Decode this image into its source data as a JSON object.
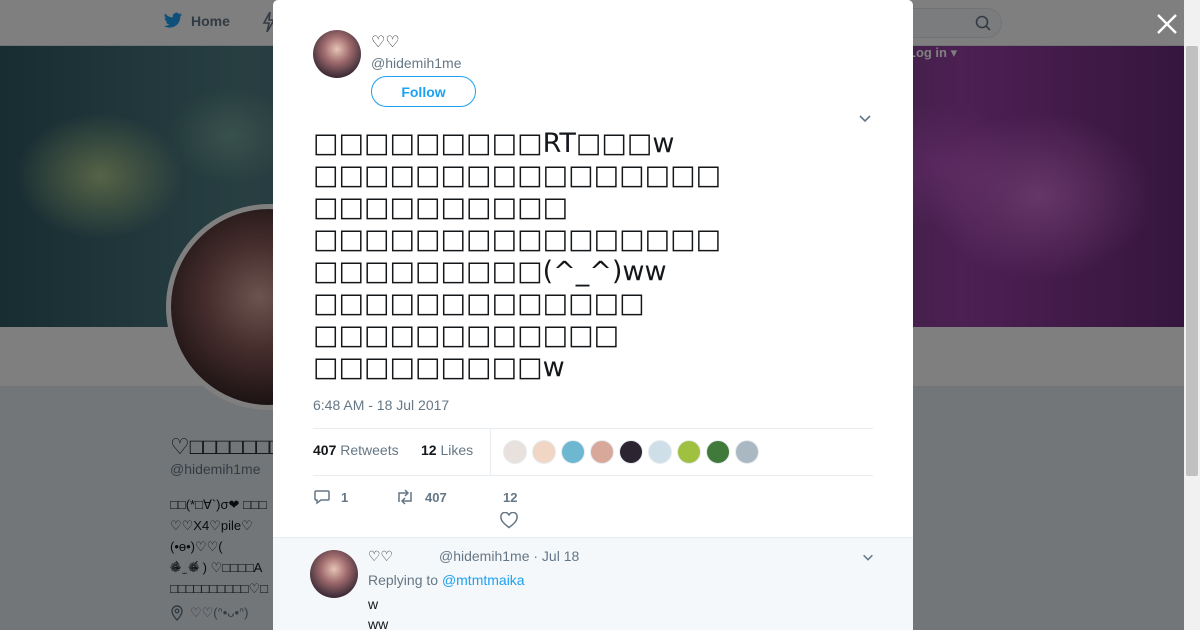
{
  "nav": {
    "home_label": "Home",
    "login_label": "Log in ▾"
  },
  "profile": {
    "name": "♡□□□□□□□□□□",
    "handle": "@hidemih1me",
    "bio": "□□(*□∀`)σ❤ □□□\n♡♡X4♡pile♡\n(•ө•)♡♡(\n❁̴̀ ̫ ❁̴́ ) ♡□□□□A\n□□□□□□□□□□♡□",
    "location": "♡♡(ᐢ•ᴗ•ᐢ)"
  },
  "tweet": {
    "name": "♡♡",
    "handle": "@hidemih1me",
    "follow_label": "Follow",
    "text": "□□□□□□□□□RT□□□w\n□□□□□□□□□□□□□□□□\n□□□□□□□□□□\n□□□□□□□□□□□□□□□□\n□□□□□□□□□(^_^)ww\n□□□□□□□□□□□□□\n□□□□□□□□□□□□\n□□□□□□□□□w",
    "timestamp": "6:48 AM - 18 Jul 2017",
    "retweets_count": "407",
    "retweets_label": "Retweets",
    "likes_count": "12",
    "likes_label": "Likes",
    "reply_count": "1",
    "retweet_action_count": "407",
    "like_action_count": "12"
  },
  "likers": [
    {
      "color": "#e8e1dd"
    },
    {
      "color": "#f2d6c5"
    },
    {
      "color": "#6db7d0"
    },
    {
      "color": "#d8a99a"
    },
    {
      "color": "#2c2531"
    },
    {
      "color": "#cfdfe8"
    },
    {
      "color": "#a0c040"
    },
    {
      "color": "#3f7a3a"
    },
    {
      "color": "#aab8c2"
    }
  ],
  "reply": {
    "name": "♡♡",
    "handle_date": "@hidemih1me · Jul 18",
    "replying_prefix": "Replying to",
    "replying_to": "@mtmtmaika",
    "line1": "w",
    "line2": "ww"
  },
  "colors": {
    "accent": "#1da1f2",
    "muted": "#657786",
    "text": "#14171a"
  }
}
